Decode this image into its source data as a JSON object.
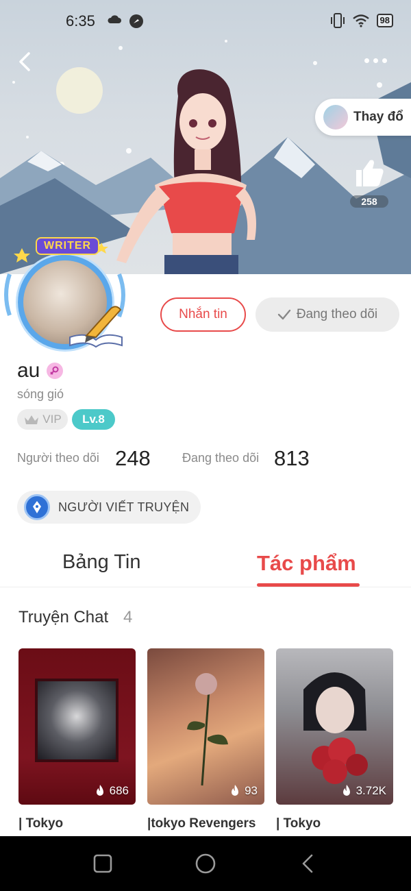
{
  "status_bar": {
    "time": "6:35",
    "battery": "98",
    "icons": [
      "cloud-icon",
      "app-notification-icon",
      "vibrate-icon",
      "wifi-icon",
      "battery-icon"
    ]
  },
  "header": {
    "back_icon": "back-arrow-icon",
    "more_icon": "more-dots-icon",
    "change_label": "Thay đổ",
    "like_count": "258",
    "background_theme": "snowy mountains anime character"
  },
  "avatar": {
    "badge_text": "WRITER",
    "ring_color": "#5aa7ea"
  },
  "actions": {
    "message_label": "Nhắn tin",
    "following_label": "Đang theo dõi"
  },
  "profile": {
    "name": "au",
    "bio": "sóng gió",
    "vip_label": "VIP",
    "level_label": "Lv.8",
    "followers_label": "Người theo dõi",
    "followers_count": "248",
    "following_label": "Đang theo dõi",
    "following_count": "813",
    "role_label": "NGƯỜI VIẾT TRUYỆN"
  },
  "tabs": [
    {
      "label": "Bảng Tin",
      "active": false
    },
    {
      "label": "Tác phẩm",
      "active": true
    }
  ],
  "section": {
    "title": "Truyện Chat",
    "count": "4"
  },
  "stories": [
    {
      "title": "| Tokyo",
      "views": "686"
    },
    {
      "title": "|tokyo Revengers",
      "views": "93"
    },
    {
      "title": "| Tokyo",
      "views": "3.72K"
    }
  ],
  "colors": {
    "accent": "#e84a4a",
    "level_badge": "#4cc9c9",
    "role_icon": "#2f71d6"
  }
}
